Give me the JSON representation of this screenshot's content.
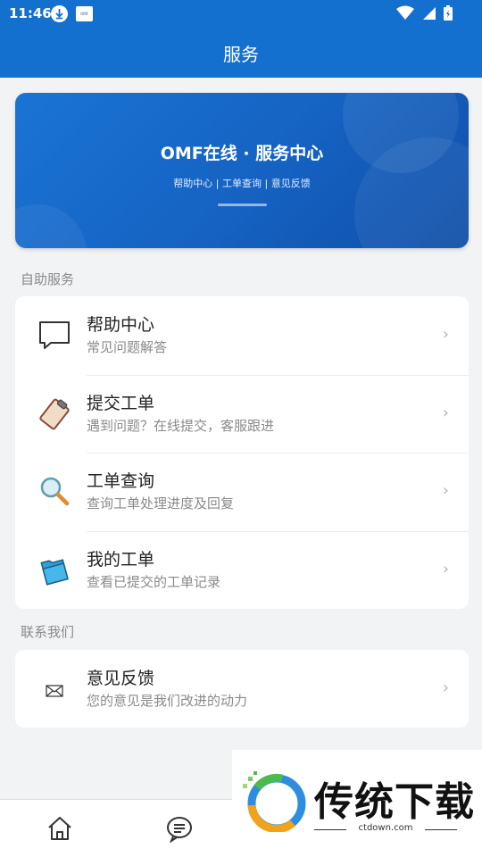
{
  "status_bar": {
    "time": "11:46",
    "app_logo_text": "OMF"
  },
  "header": {
    "title": "服务"
  },
  "banner": {
    "title": "OMF在线 · 服务中心",
    "subtitle": "帮助中心 | 工单查询 | 意见反馈"
  },
  "self_service": {
    "heading": "自助服务",
    "items": [
      {
        "title": "帮助中心",
        "subtitle": "常见问题解答",
        "icon": "chat-bubble-icon"
      },
      {
        "title": "提交工单",
        "subtitle": "遇到问题？在线提交，客服跟进",
        "icon": "clipboard-icon"
      },
      {
        "title": "工单查询",
        "subtitle": "查询工单处理进度及回复",
        "icon": "magnifier-icon"
      },
      {
        "title": "我的工单",
        "subtitle": "查看已提交的工单记录",
        "icon": "folder-icon"
      }
    ]
  },
  "contact": {
    "heading": "联系我们",
    "items": [
      {
        "title": "意见反馈",
        "subtitle": "您的意见是我们改进的动力",
        "icon": "envelope-icon"
      }
    ]
  },
  "chevron": "›",
  "bottom_nav": {
    "items": [
      "home-icon",
      "message-icon"
    ]
  },
  "watermark": {
    "text": "传统下载",
    "url": "ctdown.com"
  },
  "colors": {
    "primary": "#1470cf",
    "background": "#f2f3f5"
  }
}
